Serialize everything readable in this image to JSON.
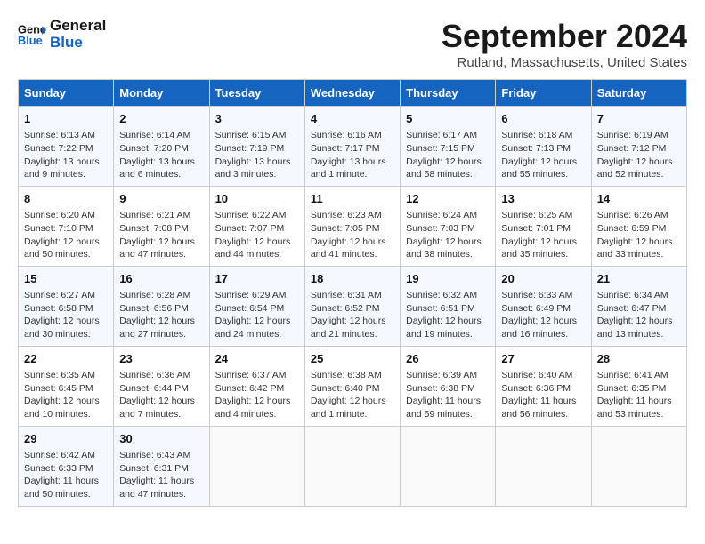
{
  "header": {
    "logo_line1": "General",
    "logo_line2": "Blue",
    "month": "September 2024",
    "location": "Rutland, Massachusetts, United States"
  },
  "weekdays": [
    "Sunday",
    "Monday",
    "Tuesday",
    "Wednesday",
    "Thursday",
    "Friday",
    "Saturday"
  ],
  "weeks": [
    [
      {
        "day": "1",
        "lines": [
          "Sunrise: 6:13 AM",
          "Sunset: 7:22 PM",
          "Daylight: 13 hours",
          "and 9 minutes."
        ]
      },
      {
        "day": "2",
        "lines": [
          "Sunrise: 6:14 AM",
          "Sunset: 7:20 PM",
          "Daylight: 13 hours",
          "and 6 minutes."
        ]
      },
      {
        "day": "3",
        "lines": [
          "Sunrise: 6:15 AM",
          "Sunset: 7:19 PM",
          "Daylight: 13 hours",
          "and 3 minutes."
        ]
      },
      {
        "day": "4",
        "lines": [
          "Sunrise: 6:16 AM",
          "Sunset: 7:17 PM",
          "Daylight: 13 hours",
          "and 1 minute."
        ]
      },
      {
        "day": "5",
        "lines": [
          "Sunrise: 6:17 AM",
          "Sunset: 7:15 PM",
          "Daylight: 12 hours",
          "and 58 minutes."
        ]
      },
      {
        "day": "6",
        "lines": [
          "Sunrise: 6:18 AM",
          "Sunset: 7:13 PM",
          "Daylight: 12 hours",
          "and 55 minutes."
        ]
      },
      {
        "day": "7",
        "lines": [
          "Sunrise: 6:19 AM",
          "Sunset: 7:12 PM",
          "Daylight: 12 hours",
          "and 52 minutes."
        ]
      }
    ],
    [
      {
        "day": "8",
        "lines": [
          "Sunrise: 6:20 AM",
          "Sunset: 7:10 PM",
          "Daylight: 12 hours",
          "and 50 minutes."
        ]
      },
      {
        "day": "9",
        "lines": [
          "Sunrise: 6:21 AM",
          "Sunset: 7:08 PM",
          "Daylight: 12 hours",
          "and 47 minutes."
        ]
      },
      {
        "day": "10",
        "lines": [
          "Sunrise: 6:22 AM",
          "Sunset: 7:07 PM",
          "Daylight: 12 hours",
          "and 44 minutes."
        ]
      },
      {
        "day": "11",
        "lines": [
          "Sunrise: 6:23 AM",
          "Sunset: 7:05 PM",
          "Daylight: 12 hours",
          "and 41 minutes."
        ]
      },
      {
        "day": "12",
        "lines": [
          "Sunrise: 6:24 AM",
          "Sunset: 7:03 PM",
          "Daylight: 12 hours",
          "and 38 minutes."
        ]
      },
      {
        "day": "13",
        "lines": [
          "Sunrise: 6:25 AM",
          "Sunset: 7:01 PM",
          "Daylight: 12 hours",
          "and 35 minutes."
        ]
      },
      {
        "day": "14",
        "lines": [
          "Sunrise: 6:26 AM",
          "Sunset: 6:59 PM",
          "Daylight: 12 hours",
          "and 33 minutes."
        ]
      }
    ],
    [
      {
        "day": "15",
        "lines": [
          "Sunrise: 6:27 AM",
          "Sunset: 6:58 PM",
          "Daylight: 12 hours",
          "and 30 minutes."
        ]
      },
      {
        "day": "16",
        "lines": [
          "Sunrise: 6:28 AM",
          "Sunset: 6:56 PM",
          "Daylight: 12 hours",
          "and 27 minutes."
        ]
      },
      {
        "day": "17",
        "lines": [
          "Sunrise: 6:29 AM",
          "Sunset: 6:54 PM",
          "Daylight: 12 hours",
          "and 24 minutes."
        ]
      },
      {
        "day": "18",
        "lines": [
          "Sunrise: 6:31 AM",
          "Sunset: 6:52 PM",
          "Daylight: 12 hours",
          "and 21 minutes."
        ]
      },
      {
        "day": "19",
        "lines": [
          "Sunrise: 6:32 AM",
          "Sunset: 6:51 PM",
          "Daylight: 12 hours",
          "and 19 minutes."
        ]
      },
      {
        "day": "20",
        "lines": [
          "Sunrise: 6:33 AM",
          "Sunset: 6:49 PM",
          "Daylight: 12 hours",
          "and 16 minutes."
        ]
      },
      {
        "day": "21",
        "lines": [
          "Sunrise: 6:34 AM",
          "Sunset: 6:47 PM",
          "Daylight: 12 hours",
          "and 13 minutes."
        ]
      }
    ],
    [
      {
        "day": "22",
        "lines": [
          "Sunrise: 6:35 AM",
          "Sunset: 6:45 PM",
          "Daylight: 12 hours",
          "and 10 minutes."
        ]
      },
      {
        "day": "23",
        "lines": [
          "Sunrise: 6:36 AM",
          "Sunset: 6:44 PM",
          "Daylight: 12 hours",
          "and 7 minutes."
        ]
      },
      {
        "day": "24",
        "lines": [
          "Sunrise: 6:37 AM",
          "Sunset: 6:42 PM",
          "Daylight: 12 hours",
          "and 4 minutes."
        ]
      },
      {
        "day": "25",
        "lines": [
          "Sunrise: 6:38 AM",
          "Sunset: 6:40 PM",
          "Daylight: 12 hours",
          "and 1 minute."
        ]
      },
      {
        "day": "26",
        "lines": [
          "Sunrise: 6:39 AM",
          "Sunset: 6:38 PM",
          "Daylight: 11 hours",
          "and 59 minutes."
        ]
      },
      {
        "day": "27",
        "lines": [
          "Sunrise: 6:40 AM",
          "Sunset: 6:36 PM",
          "Daylight: 11 hours",
          "and 56 minutes."
        ]
      },
      {
        "day": "28",
        "lines": [
          "Sunrise: 6:41 AM",
          "Sunset: 6:35 PM",
          "Daylight: 11 hours",
          "and 53 minutes."
        ]
      }
    ],
    [
      {
        "day": "29",
        "lines": [
          "Sunrise: 6:42 AM",
          "Sunset: 6:33 PM",
          "Daylight: 11 hours",
          "and 50 minutes."
        ]
      },
      {
        "day": "30",
        "lines": [
          "Sunrise: 6:43 AM",
          "Sunset: 6:31 PM",
          "Daylight: 11 hours",
          "and 47 minutes."
        ]
      },
      {
        "day": "",
        "lines": []
      },
      {
        "day": "",
        "lines": []
      },
      {
        "day": "",
        "lines": []
      },
      {
        "day": "",
        "lines": []
      },
      {
        "day": "",
        "lines": []
      }
    ]
  ]
}
